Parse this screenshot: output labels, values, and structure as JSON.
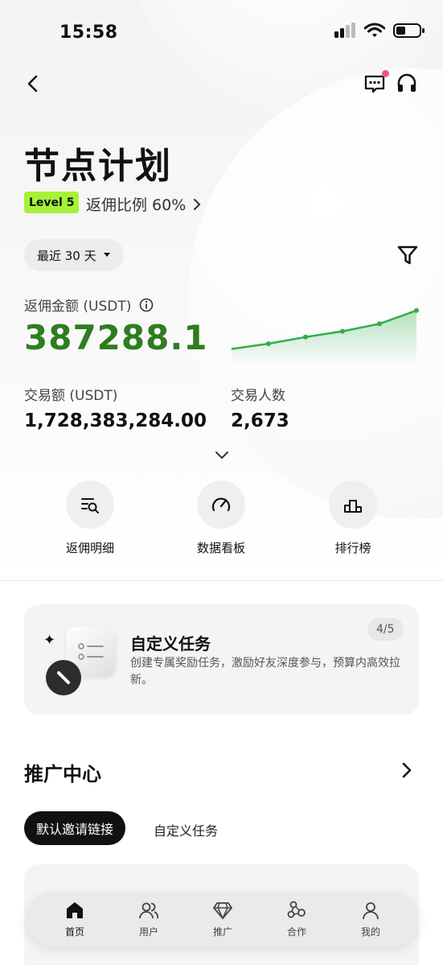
{
  "status_bar": {
    "time": "15:58"
  },
  "header": {
    "title": "节点计划",
    "level": "Level 5",
    "rebate_ratio": "返佣比例 60%"
  },
  "filter": {
    "date_range": "最近 30 天"
  },
  "rebate": {
    "label": "返佣金额 (USDT)",
    "value": "387288.1",
    "trend": [
      0.08,
      0.2,
      0.35,
      0.48,
      0.65,
      0.95
    ]
  },
  "stats": {
    "volume_label": "交易额 (USDT)",
    "volume_value": "1,728,383,284.00",
    "traders_label": "交易人数",
    "traders_value": "2,673"
  },
  "quick_actions": [
    {
      "label": "返佣明细",
      "icon": "list-search-icon"
    },
    {
      "label": "数据看板",
      "icon": "gauge-icon"
    },
    {
      "label": "排行榜",
      "icon": "podium-icon"
    }
  ],
  "task_card": {
    "title": "自定义任务",
    "description": "创建专属奖励任务，激励好友深度参与，预算内高效拉新。",
    "count": "4/5"
  },
  "promo": {
    "title": "推广中心",
    "tabs": [
      "默认邀请链接",
      "自定义任务"
    ]
  },
  "tabbar": [
    {
      "label": "首页",
      "icon": "home-icon",
      "active": true
    },
    {
      "label": "用户",
      "icon": "users-icon",
      "active": false
    },
    {
      "label": "推广",
      "icon": "diamond-icon",
      "active": false
    },
    {
      "label": "合作",
      "icon": "network-icon",
      "active": false
    },
    {
      "label": "我的",
      "icon": "profile-icon",
      "active": false
    }
  ],
  "colors": {
    "accent_green": "#2e7d1f",
    "level_badge": "#a6f237",
    "notification_dot": "#f2547a"
  }
}
